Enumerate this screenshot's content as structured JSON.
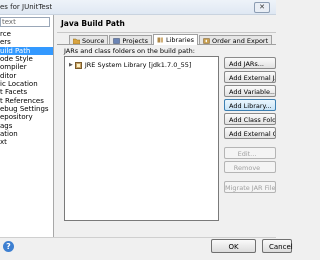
{
  "window": {
    "title": "es for JUnitTest",
    "close": "✕"
  },
  "filter": {
    "value": "text"
  },
  "nav_items": [
    {
      "label": "rce"
    },
    {
      "label": "ers"
    },
    {
      "label": "uild Path",
      "selected": true
    },
    {
      "label": "ode Style"
    },
    {
      "label": "ompiler"
    },
    {
      "label": "ditor"
    },
    {
      "label": "ic Location"
    },
    {
      "label": "t Facets"
    },
    {
      "label": "t References"
    },
    {
      "label": "ebug Settings"
    },
    {
      "label": "epository"
    },
    {
      "label": "ags"
    },
    {
      "label": "ation"
    },
    {
      "label": "xt"
    }
  ],
  "panel": {
    "title": "Java Build Path"
  },
  "tabs": [
    {
      "label": "Source",
      "icon": "source-folder-icon",
      "color": "#d9a441"
    },
    {
      "label": "Projects",
      "icon": "projects-icon",
      "color": "#6b84b5"
    },
    {
      "label": "Libraries",
      "icon": "libraries-icon",
      "color": "#b08a4a",
      "active": true
    },
    {
      "label": "Order and Export",
      "icon": "order-export-icon",
      "color": "#c9a050"
    }
  ],
  "libraries": {
    "list_label": "JARs and class folders on the build path:",
    "entries": [
      {
        "label": "JRE System Library [jdk1.7.0_55]",
        "icon": "library-icon"
      }
    ]
  },
  "buttons": [
    {
      "label": "Add JARs...",
      "enabled": true
    },
    {
      "label": "Add External JARs...",
      "enabled": true
    },
    {
      "label": "Add Variable...",
      "enabled": true
    },
    {
      "label": "Add Library...",
      "enabled": true,
      "focused": true
    },
    {
      "label": "Add Class Folder...",
      "enabled": true
    },
    {
      "label": "Add External Class Folder...",
      "enabled": true
    },
    {
      "label": "Edit...",
      "enabled": false
    },
    {
      "label": "Remove",
      "enabled": false
    },
    {
      "label": "Migrate JAR File...",
      "enabled": false
    }
  ],
  "dialog": {
    "ok": "OK",
    "cancel": "Cancel",
    "help_icon": "?"
  },
  "colors": {
    "selection": "#3399ff",
    "focus_border": "#3c7fb1",
    "help_blue": "#3d7fd1"
  }
}
